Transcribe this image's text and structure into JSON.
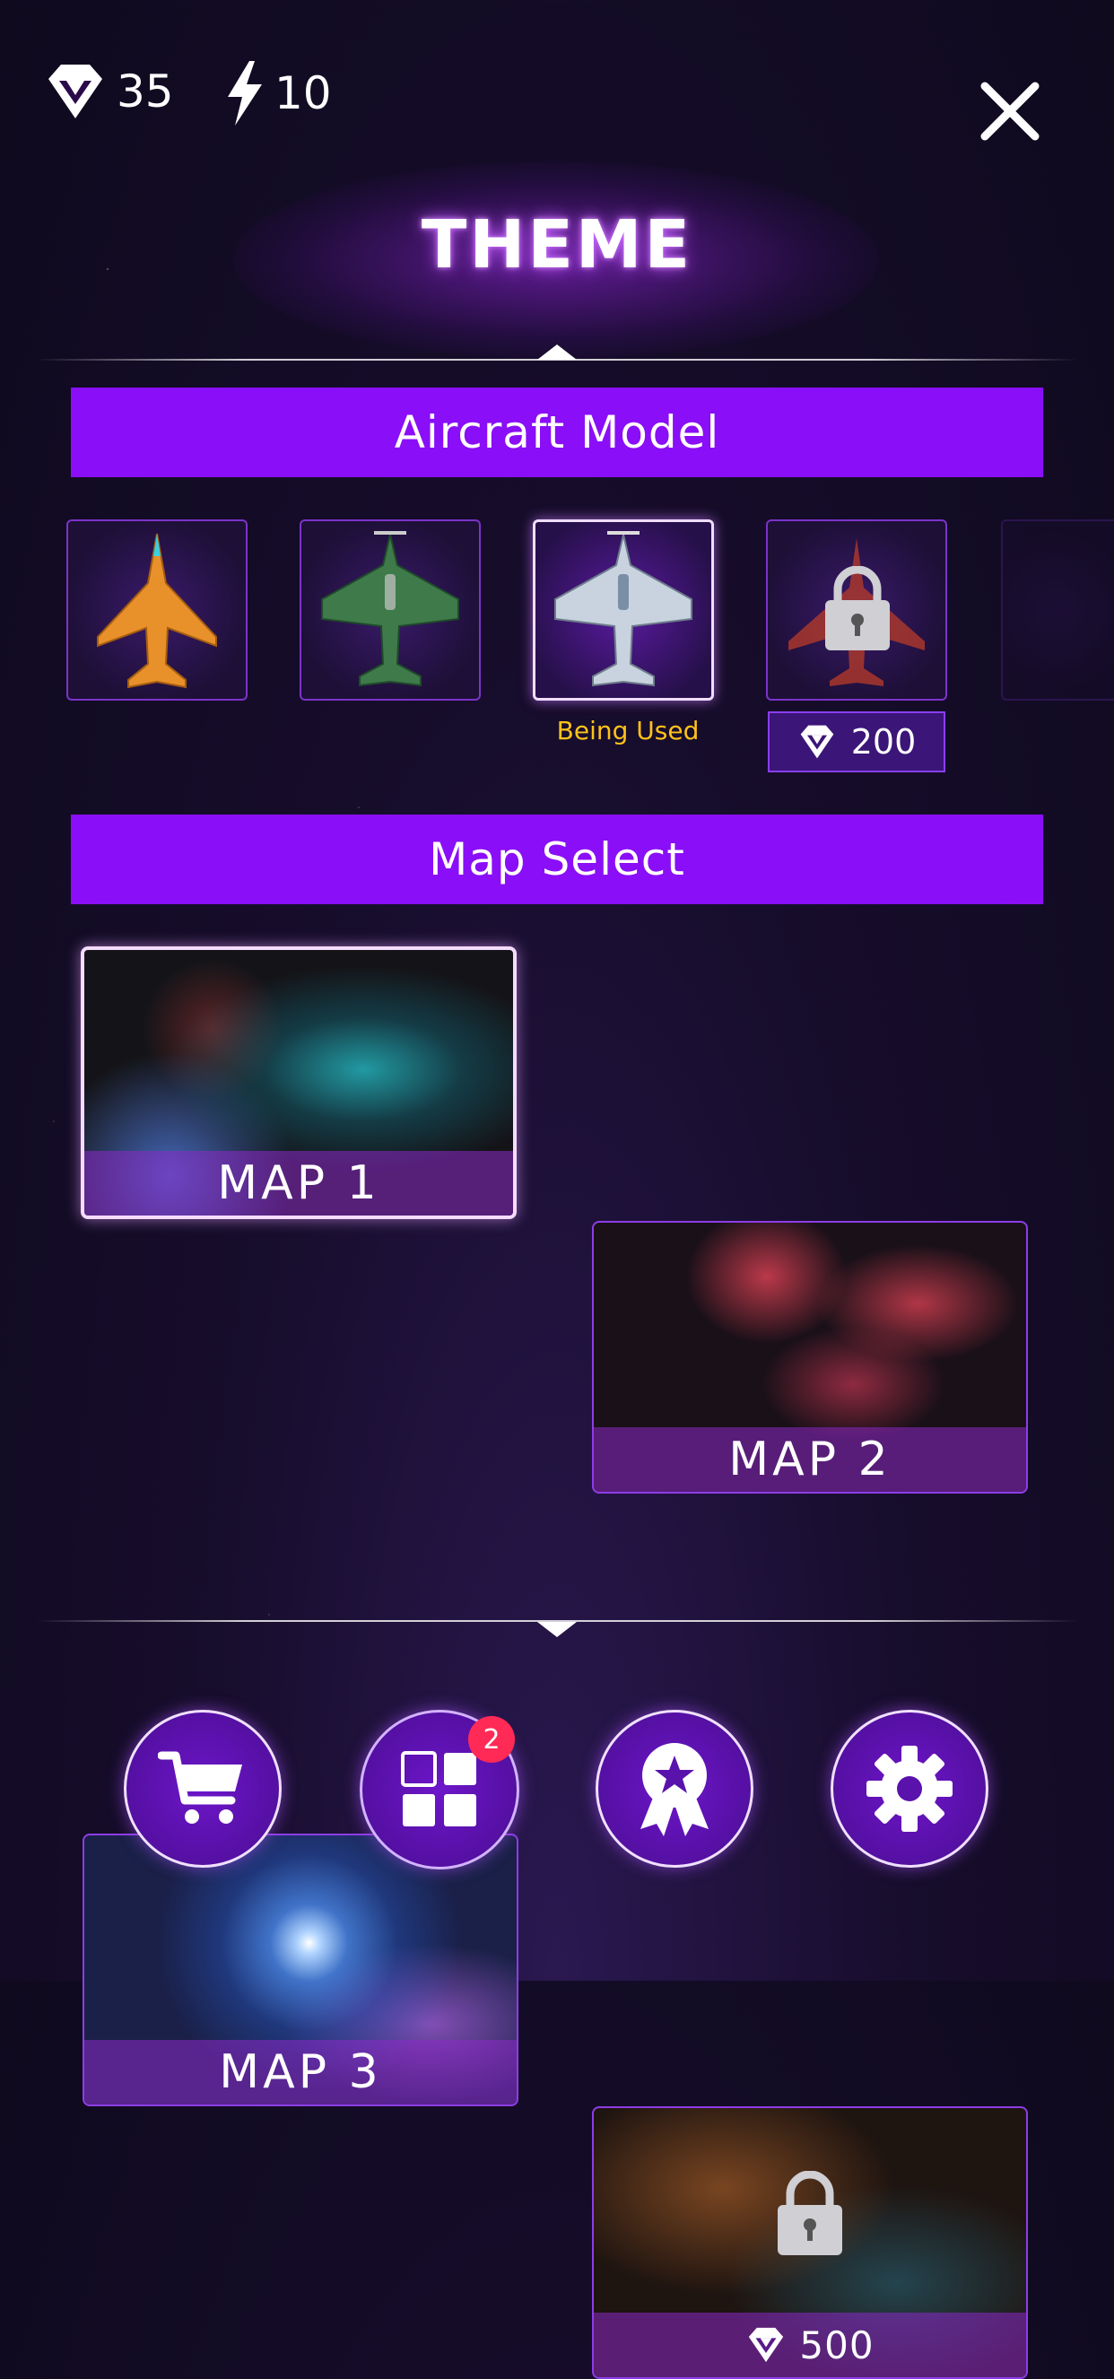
{
  "header": {
    "gems": "35",
    "energy": "10",
    "title": "THEME"
  },
  "aircraft_section": {
    "title": "Aircraft Model",
    "being_used_label": "Being Used",
    "locked_price": "200",
    "items": [
      {
        "name": "orange-jet",
        "color": "#e8902a",
        "state": "owned"
      },
      {
        "name": "green-propeller-plane",
        "color": "#3f7a4a",
        "state": "owned"
      },
      {
        "name": "silver-propeller-plane",
        "color": "#c8d3df",
        "state": "in-use"
      },
      {
        "name": "red-jet",
        "color": "#b03a2a",
        "state": "locked"
      },
      {
        "name": "hidden-aircraft",
        "color": "#4a3a5a",
        "state": "partially-visible"
      }
    ]
  },
  "map_section": {
    "title": "Map Select",
    "maps": [
      {
        "label": "MAP 1",
        "state": "selected"
      },
      {
        "label": "MAP 2",
        "state": "owned"
      },
      {
        "label": "MAP 3",
        "state": "owned"
      },
      {
        "label": "",
        "price": "500",
        "state": "locked"
      }
    ]
  },
  "nav": {
    "badge_count": "2",
    "items": [
      "shop-cart-icon",
      "theme-grid-icon",
      "achievement-medal-icon",
      "settings-gear-icon"
    ]
  },
  "colors": {
    "accent_purple": "#8a0ef7",
    "being_used_yellow": "#ffc21a",
    "badge_red": "#ff2a55"
  }
}
